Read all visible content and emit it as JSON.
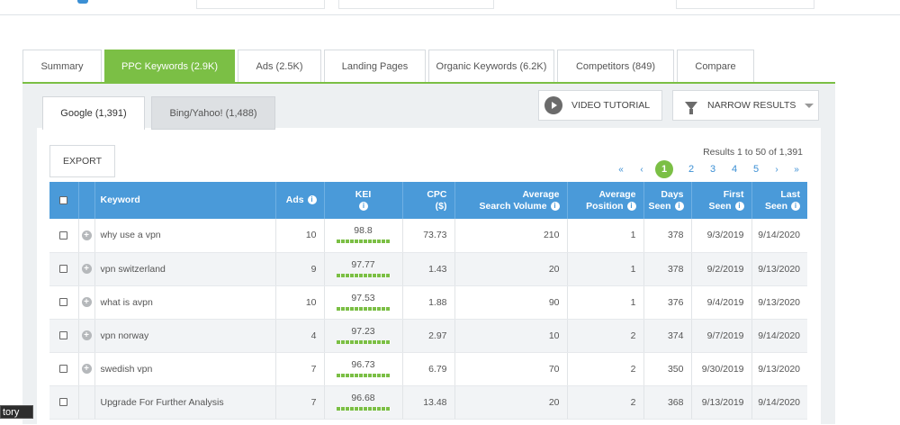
{
  "tabs": [
    {
      "label": "Summary"
    },
    {
      "label": "PPC Keywords (2.9K)",
      "active": true
    },
    {
      "label": "Ads (2.5K)"
    },
    {
      "label": "Landing Pages"
    },
    {
      "label": "Organic Keywords (6.2K)"
    },
    {
      "label": "Competitors (849)"
    },
    {
      "label": "Compare"
    }
  ],
  "engine_tabs": [
    {
      "label": "Google (1,391)",
      "active": true
    },
    {
      "label": "Bing/Yahoo! (1,488)"
    }
  ],
  "toolbar": {
    "video_label": "VIDEO TUTORIAL",
    "narrow_label": "NARROW RESULTS",
    "export_label": "EXPORT"
  },
  "results": {
    "summary": "Results 1 to 50 of 1,391",
    "first": "«",
    "prev": "‹",
    "current": "1",
    "pages": [
      "2",
      "3",
      "4",
      "5"
    ],
    "next": "›",
    "last": "»"
  },
  "table": {
    "headers": {
      "keyword": "Keyword",
      "ads": "Ads",
      "kei": "KEI",
      "cpc_line1": "CPC",
      "cpc_line2": "($)",
      "avg_sv_line1": "Average",
      "avg_sv_line2": "Search Volume",
      "avg_pos_line1": "Average",
      "avg_pos_line2": "Position",
      "days_line1": "Days",
      "days_line2": "Seen",
      "first_line1": "First",
      "first_line2": "Seen",
      "last_line1": "Last",
      "last_line2": "Seen"
    },
    "rows": [
      {
        "keyword": "why use a vpn",
        "ads": "10",
        "kei": "98.8",
        "cpc": "73.73",
        "volume": "210",
        "position": "1",
        "days": "378",
        "first": "9/3/2019",
        "last": "9/14/2020"
      },
      {
        "keyword": "vpn switzerland",
        "ads": "9",
        "kei": "97.77",
        "cpc": "1.43",
        "volume": "20",
        "position": "1",
        "days": "378",
        "first": "9/2/2019",
        "last": "9/13/2020"
      },
      {
        "keyword": "what is avpn",
        "ads": "10",
        "kei": "97.53",
        "cpc": "1.88",
        "volume": "90",
        "position": "1",
        "days": "376",
        "first": "9/4/2019",
        "last": "9/13/2020"
      },
      {
        "keyword": "vpn norway",
        "ads": "4",
        "kei": "97.23",
        "cpc": "2.97",
        "volume": "10",
        "position": "2",
        "days": "374",
        "first": "9/7/2019",
        "last": "9/14/2020"
      },
      {
        "keyword": "swedish vpn",
        "ads": "7",
        "kei": "96.73",
        "cpc": "6.79",
        "volume": "70",
        "position": "2",
        "days": "350",
        "first": "9/30/2019",
        "last": "9/13/2020"
      },
      {
        "keyword": "Upgrade For Further Analysis",
        "ads": "7",
        "kei": "96.68",
        "cpc": "13.48",
        "volume": "20",
        "position": "2",
        "days": "368",
        "first": "9/13/2019",
        "last": "9/14/2020"
      }
    ]
  },
  "tooltip_fragment": "tory"
}
